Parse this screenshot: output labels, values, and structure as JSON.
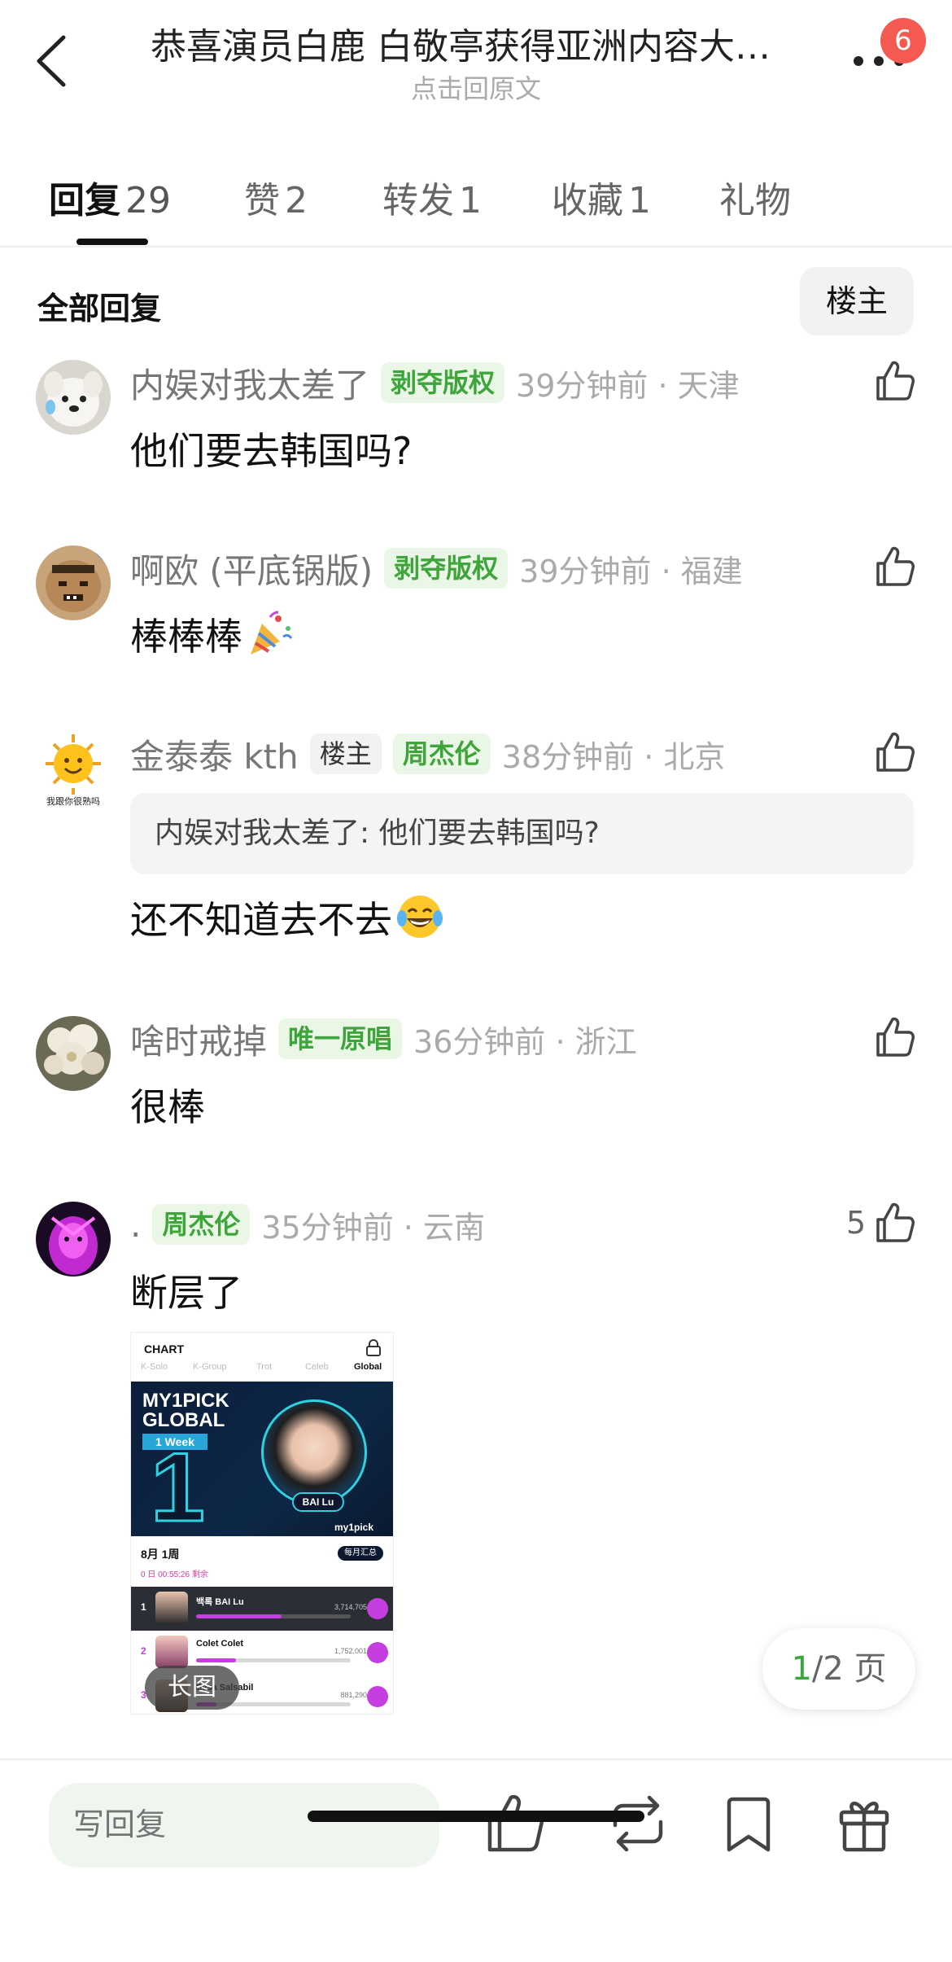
{
  "header": {
    "title": "恭喜演员白鹿 白敬亭获得亚洲内容大…",
    "subtitle": "点击回原文",
    "notification_count": "6"
  },
  "tabs": [
    {
      "label": "回复",
      "count": "29",
      "active": true
    },
    {
      "label": "赞",
      "count": "2"
    },
    {
      "label": "转发",
      "count": "1"
    },
    {
      "label": "收藏",
      "count": "1"
    },
    {
      "label": "礼物",
      "count": ""
    }
  ],
  "filter": {
    "all_label": "全部回复",
    "owner_label": "楼主"
  },
  "comments": [
    {
      "username": "内娱对我太差了",
      "badges": [
        "剥夺版权"
      ],
      "time": "39分钟前 · 天津",
      "text": "他们要去韩国吗?"
    },
    {
      "username": "啊欧 (平底锅版)",
      "badges": [
        "剥夺版权"
      ],
      "time": "39分钟前 · 福建",
      "text": "棒棒棒",
      "emoji": "party-popper"
    },
    {
      "username": "金泰泰 kth",
      "badges": [
        "楼主",
        "周杰伦"
      ],
      "time": "38分钟前 · 北京",
      "quote": "内娱对我太差了:  他们要去韩国吗?",
      "text": "还不知道去不去",
      "emoji": "tears-of-joy",
      "avatar_caption": "我跟你很熟吗"
    },
    {
      "username": "啥时戒掉",
      "badges": [
        "唯一原唱"
      ],
      "time": "36分钟前 · 浙江",
      "text": "很棒"
    },
    {
      "username": ".",
      "badges": [
        "周杰伦"
      ],
      "time": "35分钟前 · 云南",
      "text": "断层了",
      "likes": "5",
      "image_label": "长图"
    }
  ],
  "chart_image": {
    "header": "CHART",
    "tabs": [
      "K-Solo",
      "K-Group",
      "Trot",
      "Celeb",
      "Global"
    ],
    "brand_line1": "MY1PICK",
    "brand_line2": "GLOBAL",
    "week_label": "1 Week",
    "rank_number": "1",
    "artist_name": "BAI Lu",
    "logo": "my1pick",
    "period": "8月 1周",
    "vote_button": "每月汇总",
    "remaining": "0 日 00:55:26 剩余",
    "rows": [
      {
        "rank": "1",
        "name": "백록 BAI Lu",
        "votes": "3,714,705",
        "share": 0.55
      },
      {
        "rank": "2",
        "name": "Colet Colet",
        "votes": "1,752,001",
        "share": 0.26
      },
      {
        "rank": "3",
        "name": "Sasa Salsabil",
        "votes": "881,290",
        "share": 0.13
      }
    ]
  },
  "pager": {
    "current": "1",
    "total": "/2 页"
  },
  "bottom": {
    "reply_placeholder": "写回复"
  },
  "colors": {
    "accent_green": "#3da53a",
    "badge_bg": "#eaf7e6",
    "notification_red": "#f45a52"
  }
}
